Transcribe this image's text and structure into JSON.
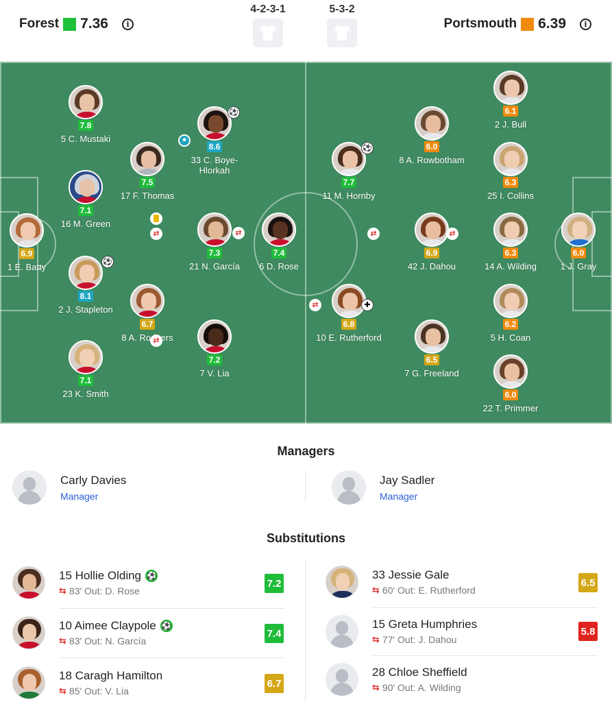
{
  "header": {
    "home": {
      "name": "Forest",
      "rating": "7.36",
      "color": "#1fc13a"
    },
    "away": {
      "name": "Portsmouth",
      "rating": "6.39",
      "color": "#f08a0c"
    },
    "home_formation": "4-2-3-1",
    "away_formation": "5-3-2"
  },
  "rating_colors": {
    "green": "#1fbc3a",
    "yellow": "#d4a717",
    "orange": "#f08a0c",
    "teal": "#1ea6c4",
    "red": "#e0231f"
  },
  "pitch": {
    "home_players": [
      {
        "label": "5 C. Mustaki",
        "rating": "7.8",
        "band": "green"
      },
      {
        "label": "33 C. Boye-Hlorkah",
        "rating": "8.6",
        "band": "teal"
      },
      {
        "label": "17 F. Thomas",
        "rating": "7.5",
        "band": "green"
      },
      {
        "label": "16 M. Green",
        "rating": "7.1",
        "band": "green"
      },
      {
        "label": "1 E. Batty",
        "rating": "6.9",
        "band": "yellow"
      },
      {
        "label": "21 N. García",
        "rating": "7.3",
        "band": "green"
      },
      {
        "label": "6 D. Rose",
        "rating": "7.4",
        "band": "green"
      },
      {
        "label": "2 J. Stapleton",
        "rating": "8.1",
        "band": "teal"
      },
      {
        "label": "8 A. Rodgers",
        "rating": "6.7",
        "band": "yellow"
      },
      {
        "label": "7 V. Lia",
        "rating": "7.2",
        "band": "green"
      },
      {
        "label": "23 K. Smith",
        "rating": "7.1",
        "band": "green"
      }
    ],
    "away_players": [
      {
        "label": "2 J. Bull",
        "rating": "6.1",
        "band": "orange"
      },
      {
        "label": "8 A. Rowbotham",
        "rating": "6.0",
        "band": "orange"
      },
      {
        "label": "11 M. Hornby",
        "rating": "7.7",
        "band": "green"
      },
      {
        "label": "25 I. Collins",
        "rating": "6.3",
        "band": "orange"
      },
      {
        "label": "42 J. Dahou",
        "rating": "6.9",
        "band": "yellow"
      },
      {
        "label": "14 A. Wilding",
        "rating": "6.3",
        "band": "orange"
      },
      {
        "label": "1 J. Gray",
        "rating": "6.0",
        "band": "orange"
      },
      {
        "label": "10 E. Rutherford",
        "rating": "6.8",
        "band": "yellow"
      },
      {
        "label": "5 H. Coan",
        "rating": "6.2",
        "band": "orange"
      },
      {
        "label": "7 G. Freeland",
        "rating": "6.5",
        "band": "yellow"
      },
      {
        "label": "22 T. Primmer",
        "rating": "6.0",
        "band": "orange"
      }
    ]
  },
  "managers": {
    "title": "Managers",
    "home": {
      "name": "Carly Davies",
      "role": "Manager"
    },
    "away": {
      "name": "Jay Sadler",
      "role": "Manager"
    }
  },
  "substitutions": {
    "title": "Substitutions",
    "home": [
      {
        "name": "15 Hollie Olding",
        "detail": "83' Out: D. Rose",
        "rating": "7.2",
        "band": "green",
        "goal": true
      },
      {
        "name": "10 Aimee Claypole",
        "detail": "83' Out: N. García",
        "rating": "7.4",
        "band": "green",
        "goal": true
      },
      {
        "name": "18 Caragh Hamilton",
        "detail": "85' Out: V. Lia",
        "rating": "6.7",
        "band": "yellow",
        "goal": false
      }
    ],
    "away": [
      {
        "name": "33 Jessie Gale",
        "detail": "60' Out: E. Rutherford",
        "rating": "6.5",
        "band": "yellow",
        "goal": false
      },
      {
        "name": "15 Greta Humphries",
        "detail": "77' Out: J. Dahou",
        "rating": "5.8",
        "band": "red",
        "goal": false
      },
      {
        "name": "28 Chloe Sheffield",
        "detail": "90' Out: A. Wilding",
        "rating": "",
        "band": "",
        "goal": false
      }
    ]
  }
}
